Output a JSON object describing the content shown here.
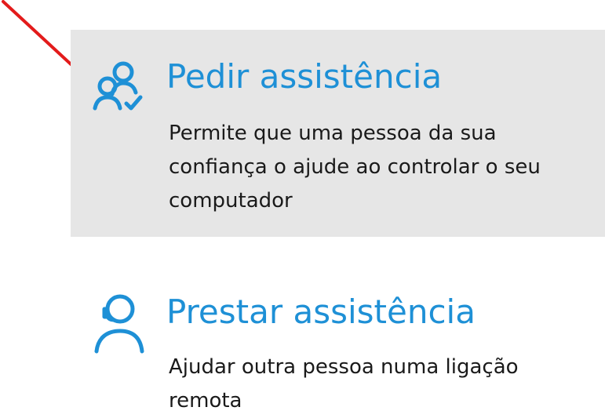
{
  "options": [
    {
      "id": "request",
      "icon": "people-check-icon",
      "title": "Pedir assistência",
      "description": "Permite que uma pessoa da sua confiança o ajude ao controlar o seu computador"
    },
    {
      "id": "provide",
      "icon": "headset-person-icon",
      "title": "Prestar assistência",
      "description": "Ajudar outra pessoa numa ligação remota"
    }
  ],
  "colors": {
    "accent": "#1e90d6",
    "highlight_bg": "#e6e6e6",
    "text": "#1a1a1a",
    "annotation": "#e31b1b"
  }
}
